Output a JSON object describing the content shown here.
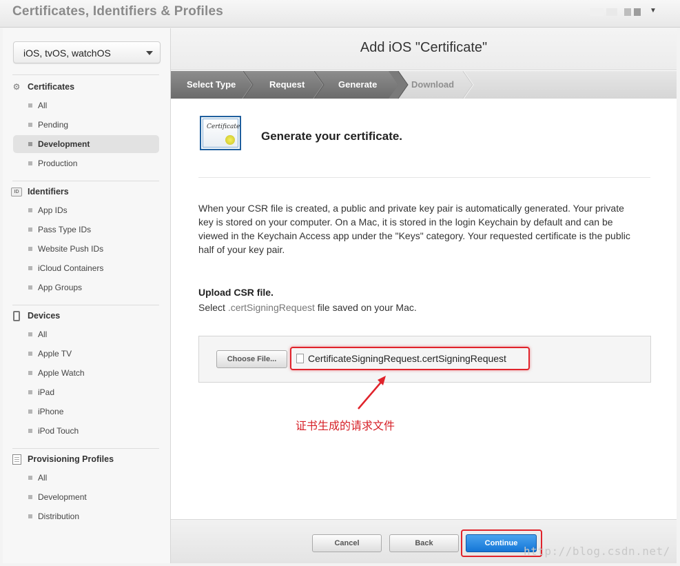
{
  "app": {
    "title": "Certificates, Identifiers & Profiles"
  },
  "sidebar": {
    "platform": "iOS, tvOS, watchOS",
    "sections": [
      {
        "title": "Certificates",
        "items": [
          "All",
          "Pending",
          "Development",
          "Production"
        ],
        "active": "Development"
      },
      {
        "title": "Identifiers",
        "icon_text": "ID",
        "items": [
          "App IDs",
          "Pass Type IDs",
          "Website Push IDs",
          "iCloud Containers",
          "App Groups"
        ]
      },
      {
        "title": "Devices",
        "items": [
          "All",
          "Apple TV",
          "Apple Watch",
          "iPad",
          "iPhone",
          "iPod Touch"
        ]
      },
      {
        "title": "Provisioning Profiles",
        "items": [
          "All",
          "Development",
          "Distribution"
        ]
      }
    ]
  },
  "main": {
    "heading": "Add iOS \"Certificate\"",
    "steps": [
      {
        "label": "Select Type",
        "state": "done"
      },
      {
        "label": "Request",
        "state": "done"
      },
      {
        "label": "Generate",
        "state": "current"
      },
      {
        "label": "Download",
        "state": "pending"
      }
    ],
    "cert_icon_text": "Certificate",
    "generate_title": "Generate your certificate.",
    "description": "When your CSR file is created, a public and private key pair is automatically generated. Your private key is stored on your computer. On a Mac, it is stored in the login Keychain by default and can be viewed in the Keychain Access app under the \"Keys\" category. Your requested certificate is the public half of your key pair.",
    "upload": {
      "title": "Upload CSR file.",
      "sub_prefix": "Select",
      "sub_ext": ".certSigningRequest",
      "sub_suffix": "file saved on your Mac.",
      "choose_label": "Choose File...",
      "file_name": "CertificateSigningRequest.certSigningRequest"
    },
    "annotation": "证书生成的请求文件",
    "footer": {
      "cancel": "Cancel",
      "back": "Back",
      "continue": "Continue"
    }
  },
  "watermark": "http://blog.csdn.net/",
  "colors": {
    "annotation": "#e0232b",
    "continue": "#1476d6",
    "steps_done": "#7a7a7a"
  },
  "icons": {
    "certificates": "gear-icon",
    "identifiers": "id-badge-icon",
    "devices": "device-icon",
    "profiles": "profile-doc-icon",
    "file": "file-icon",
    "dropdown": "chevron-down-icon"
  }
}
